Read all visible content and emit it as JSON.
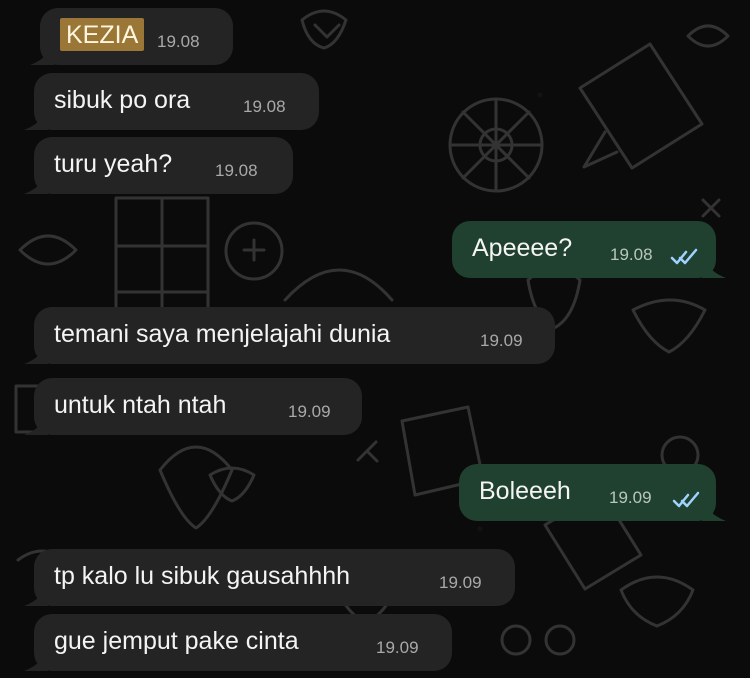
{
  "chat": {
    "messages": [
      {
        "direction": "incoming",
        "text": "KEZIA",
        "time": "19.08",
        "highlight_color": "#9b7737"
      },
      {
        "direction": "incoming",
        "text": "sibuk po ora",
        "time": "19.08"
      },
      {
        "direction": "incoming",
        "text": "turu yeah?",
        "time": "19.08"
      },
      {
        "direction": "outgoing",
        "text": "Apeeee?",
        "time": "19.08",
        "status": "read"
      },
      {
        "direction": "incoming",
        "text": "temani saya menjelajahi dunia",
        "time": "19.09"
      },
      {
        "direction": "incoming",
        "text": "untuk ntah ntah",
        "time": "19.09"
      },
      {
        "direction": "outgoing",
        "text": "Boleeeh",
        "time": "19.09",
        "status": "read"
      },
      {
        "direction": "incoming",
        "text": "tp kalo lu sibuk gausahhhh",
        "time": "19.09"
      },
      {
        "direction": "incoming",
        "text": "gue jemput pake cinta",
        "time": "19.09"
      }
    ]
  },
  "colors": {
    "background": "#0b0b0b",
    "incoming_bubble": "#242424",
    "outgoing_bubble": "#20412f",
    "text": "#f4f4f4",
    "timestamp": "#a9a9a9",
    "read_ticks": "#9fd3ff"
  },
  "icons": {
    "read_receipt": "double-check-icon",
    "wallpaper": "doodle-pattern"
  }
}
